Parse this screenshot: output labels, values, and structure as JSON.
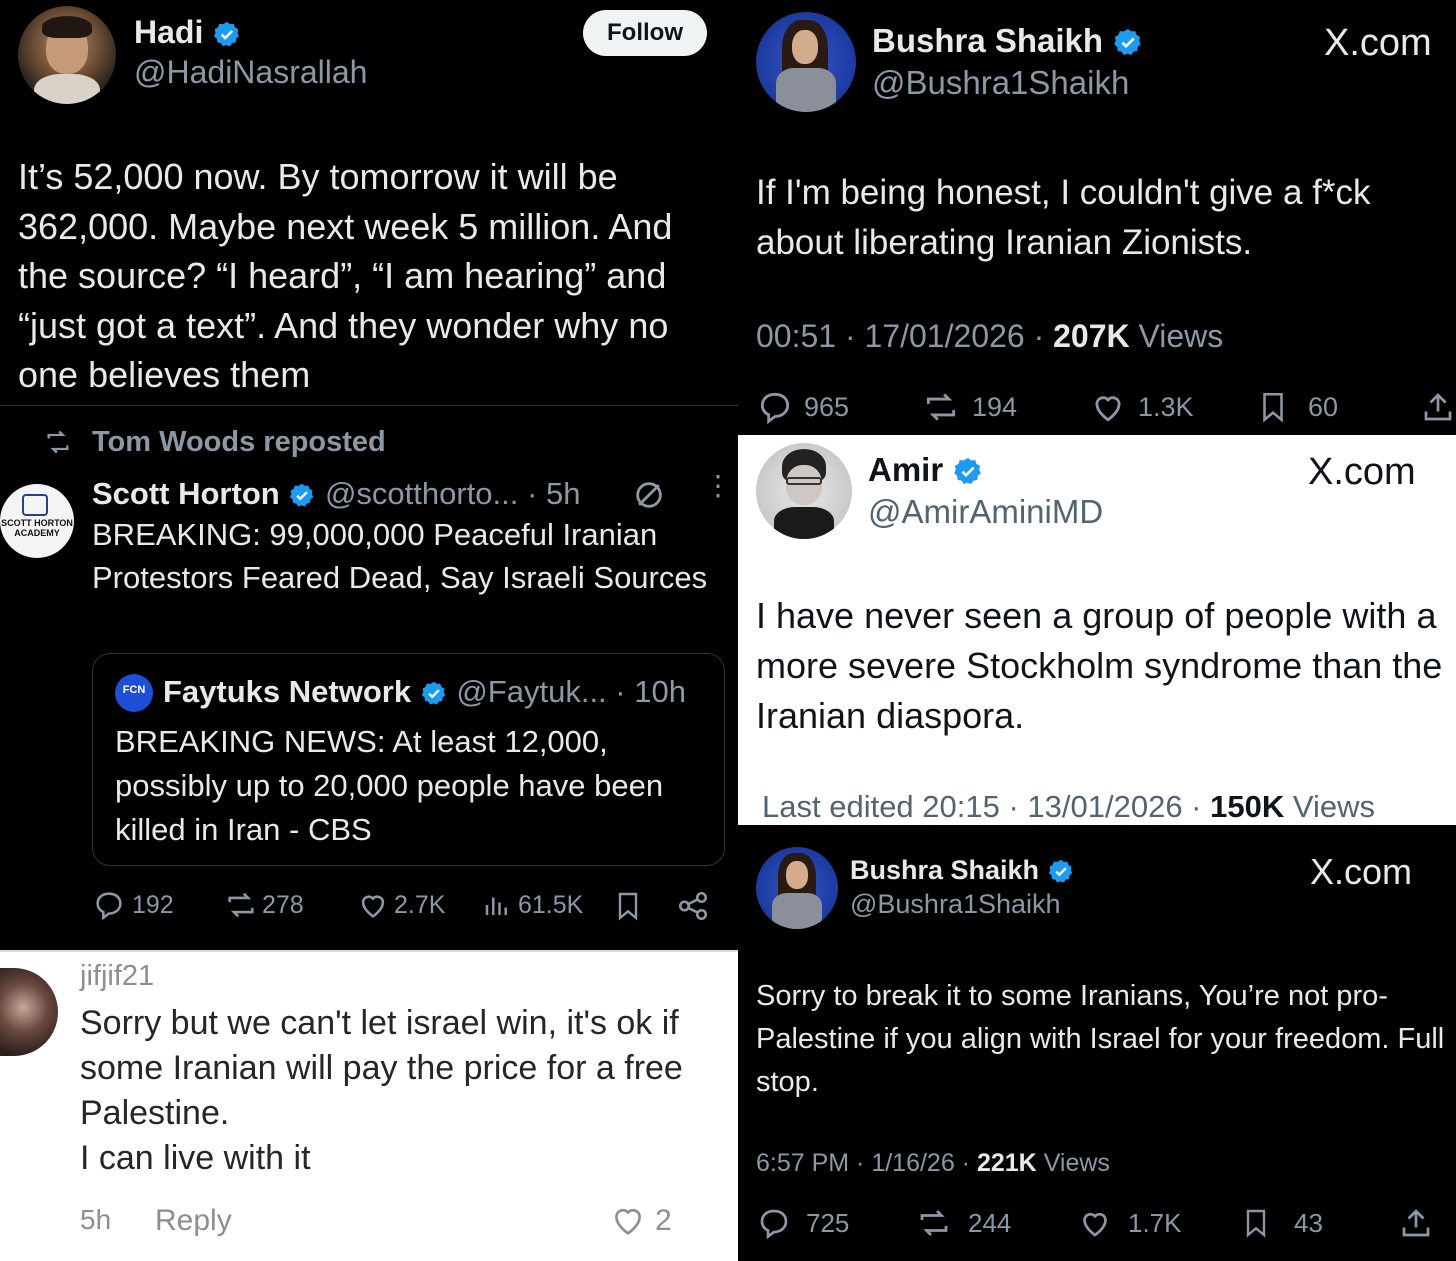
{
  "p1": {
    "name": "Hadi",
    "handle": "@HadiNasrallah",
    "follow": "Follow",
    "text": "It’s 52,000 now. By tomorrow it will be 362,000. Maybe next week 5 million. And the source? “I heard”, “I am hearing” and “just got a text”. And they wonder why no one believes them"
  },
  "p2": {
    "reposted": "Tom Woods reposted",
    "avatar_text": "SCOTT HORTON ACADEMY",
    "name": "Scott Horton",
    "handle": "@scotthorto...",
    "time": "· 5h",
    "text": "BREAKING: 99,000,000 Peaceful Iranian Protestors Feared Dead, Say Israeli Sources",
    "quote": {
      "avatar_text": "FCN",
      "name": "Faytuks Network",
      "handle": "@Faytuk...",
      "time": "· 10h",
      "text": "BREAKING NEWS: At least 12,000, possibly up to 20,000 people have been killed in Iran - CBS"
    },
    "stats": {
      "replies": "192",
      "reposts": "278",
      "likes": "2.7K",
      "views": "61.5K"
    }
  },
  "p3": {
    "name": "jifjif21",
    "text_lines": [
      "Sorry but we can't let israel win, it's ok if",
      "some Iranian will pay the price for a free",
      "Palestine.",
      "I can live with it"
    ],
    "time": "5h",
    "reply": "Reply",
    "likes": "2"
  },
  "p4": {
    "name": "Bushra Shaikh",
    "handle": "@Bushra1Shaikh",
    "xcom": "X.com",
    "text": "If I'm being honest, I couldn't give a f*ck about liberating Iranian Zionists.",
    "meta_time": "00:51 · 17/01/2026 ·",
    "meta_views_num": "207K",
    "meta_views_label": "Views",
    "stats": {
      "replies": "965",
      "reposts": "194",
      "likes": "1.3K",
      "bookmarks": "60"
    }
  },
  "p5": {
    "name": "Amir",
    "handle": "@AmirAminiMD",
    "xcom": "X.com",
    "text": "I have never seen a group of people with a more severe Stockholm syndrome than the Iranian diaspora.",
    "meta_time": "Last edited 20:15 · 13/01/2026 ·",
    "meta_views_num": "150K",
    "meta_views_label": "Views"
  },
  "p6": {
    "name": "Bushra Shaikh",
    "handle": "@Bushra1Shaikh",
    "xcom": "X.com",
    "text": "Sorry to break it to some Iranians, You’re not pro-Palestine if you align with Israel for your freedom. Full stop.",
    "meta_time": "6:57 PM · 1/16/26 ·",
    "meta_views_num": "221K",
    "meta_views_label": "Views",
    "stats": {
      "replies": "725",
      "reposts": "244",
      "likes": "1.7K",
      "bookmarks": "43"
    }
  },
  "colors": {
    "verified": "#1d9bf0",
    "dark_bg": "#000000",
    "muted": "#8b98a5"
  }
}
